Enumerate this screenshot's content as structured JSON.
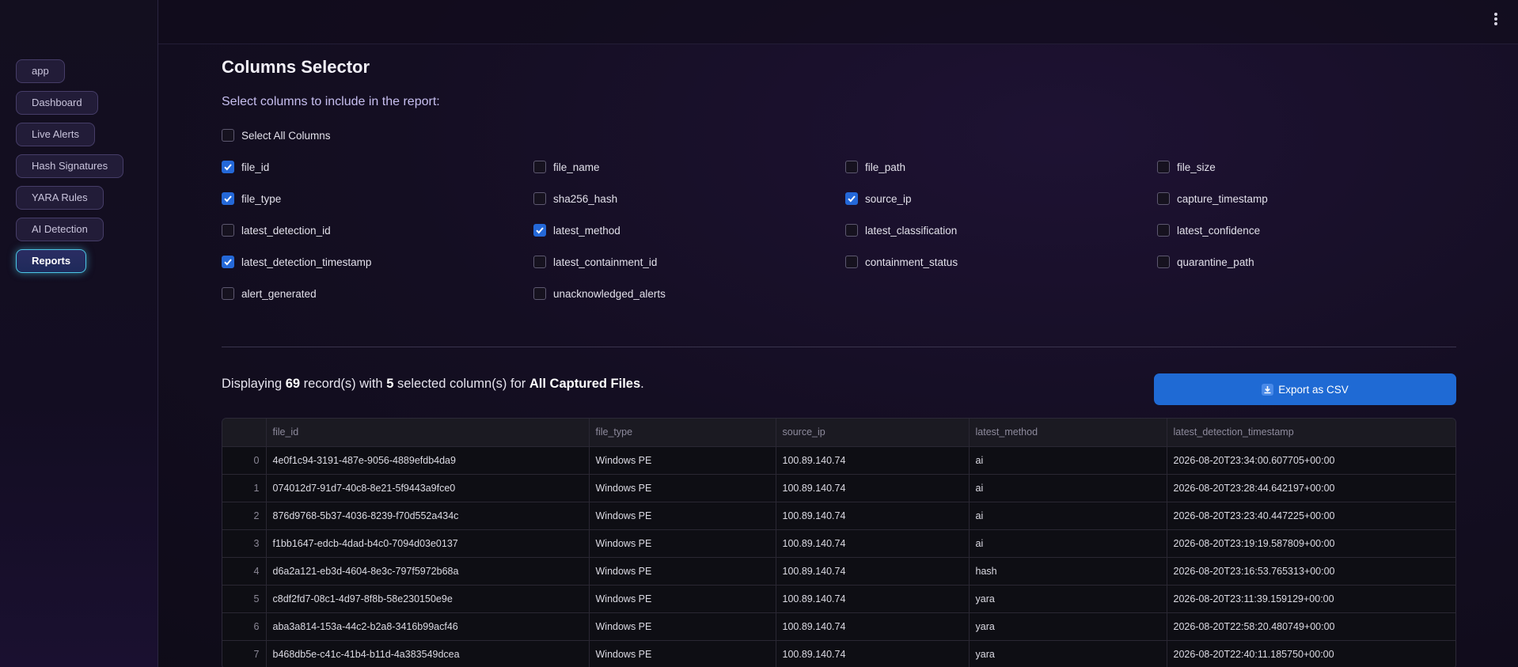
{
  "sidebar": {
    "items": [
      {
        "label": "app"
      },
      {
        "label": "Dashboard"
      },
      {
        "label": "Live Alerts"
      },
      {
        "label": "Hash Signatures"
      },
      {
        "label": "YARA Rules"
      },
      {
        "label": "AI Detection"
      },
      {
        "label": "Reports",
        "active": true
      }
    ]
  },
  "header": {
    "menu_icon": "kebab-menu-icon"
  },
  "main": {
    "title": "Columns Selector",
    "subtitle": "Select columns to include in the report:",
    "select_all": {
      "label": "Select All Columns",
      "checked": false
    },
    "columns": [
      {
        "label": "file_id",
        "checked": true
      },
      {
        "label": "file_name",
        "checked": false
      },
      {
        "label": "file_path",
        "checked": false
      },
      {
        "label": "file_size",
        "checked": false
      },
      {
        "label": "file_type",
        "checked": true
      },
      {
        "label": "sha256_hash",
        "checked": false
      },
      {
        "label": "source_ip",
        "checked": true
      },
      {
        "label": "capture_timestamp",
        "checked": false
      },
      {
        "label": "latest_detection_id",
        "checked": false
      },
      {
        "label": "latest_method",
        "checked": true
      },
      {
        "label": "latest_classification",
        "checked": false
      },
      {
        "label": "latest_confidence",
        "checked": false
      },
      {
        "label": "latest_detection_timestamp",
        "checked": true
      },
      {
        "label": "latest_containment_id",
        "checked": false
      },
      {
        "label": "containment_status",
        "checked": false
      },
      {
        "label": "quarantine_path",
        "checked": false
      },
      {
        "label": "alert_generated",
        "checked": false
      },
      {
        "label": "unacknowledged_alerts",
        "checked": false
      }
    ],
    "summary": {
      "prefix": "Displaying ",
      "record_count": "69",
      "mid1": " record(s) with ",
      "column_count": "5",
      "mid2": " selected column(s) for ",
      "scope": "All Captured Files",
      "suffix": "."
    },
    "export_button": {
      "label": "Export as CSV",
      "icon": "download-icon"
    },
    "table": {
      "headers": [
        "",
        "file_id",
        "file_type",
        "source_ip",
        "latest_method",
        "latest_detection_timestamp"
      ],
      "rows": [
        [
          "0",
          "4e0f1c94-3191-487e-9056-4889efdb4da9",
          "Windows PE",
          "100.89.140.74",
          "ai",
          "2026-08-20T23:34:00.607705+00:00"
        ],
        [
          "1",
          "074012d7-91d7-40c8-8e21-5f9443a9fce0",
          "Windows PE",
          "100.89.140.74",
          "ai",
          "2026-08-20T23:28:44.642197+00:00"
        ],
        [
          "2",
          "876d9768-5b37-4036-8239-f70d552a434c",
          "Windows PE",
          "100.89.140.74",
          "ai",
          "2026-08-20T23:23:40.447225+00:00"
        ],
        [
          "3",
          "f1bb1647-edcb-4dad-b4c0-7094d03e0137",
          "Windows PE",
          "100.89.140.74",
          "ai",
          "2026-08-20T23:19:19.587809+00:00"
        ],
        [
          "4",
          "d6a2a121-eb3d-4604-8e3c-797f5972b68a",
          "Windows PE",
          "100.89.140.74",
          "hash",
          "2026-08-20T23:16:53.765313+00:00"
        ],
        [
          "5",
          "c8df2fd7-08c1-4d97-8f8b-58e230150e9e",
          "Windows PE",
          "100.89.140.74",
          "yara",
          "2026-08-20T23:11:39.159129+00:00"
        ],
        [
          "6",
          "aba3a814-153a-44c2-b2a8-3416b99acf46",
          "Windows PE",
          "100.89.140.74",
          "yara",
          "2026-08-20T22:58:20.480749+00:00"
        ],
        [
          "7",
          "b468db5e-c41c-41b4-b11d-4a383549dcea",
          "Windows PE",
          "100.89.140.74",
          "yara",
          "2026-08-20T22:40:11.185750+00:00"
        ]
      ]
    }
  }
}
